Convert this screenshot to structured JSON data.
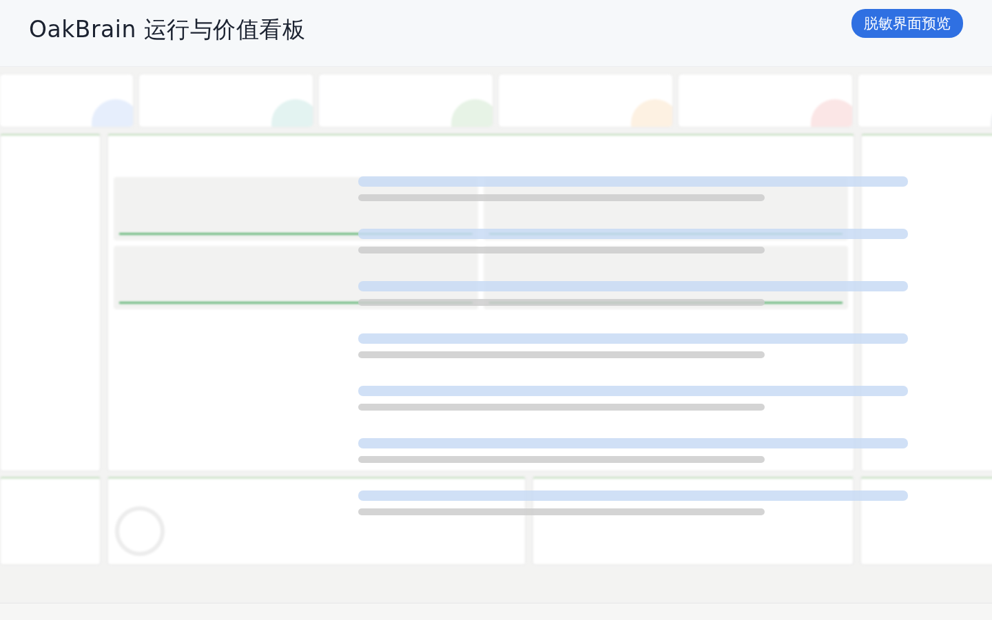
{
  "header": {
    "title": "OakBrain 运行与价值看板",
    "badge": "脱敏界面预览"
  }
}
